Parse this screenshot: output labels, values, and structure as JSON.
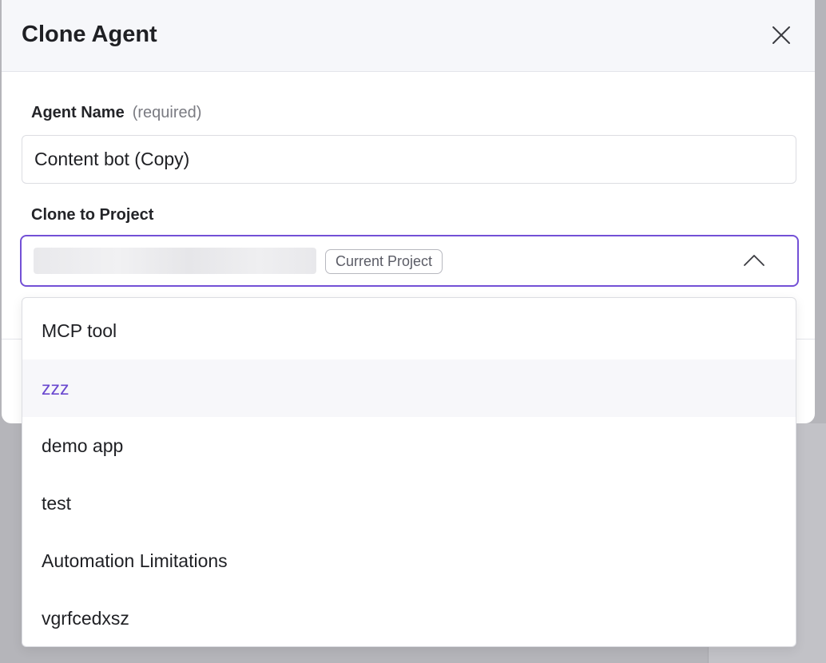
{
  "dialog": {
    "title": "Clone Agent"
  },
  "agent_name": {
    "label": "Agent Name",
    "hint": "(required)",
    "value": "Content bot (Copy)"
  },
  "clone_to_project": {
    "label": "Clone to Project",
    "selected_badge": "Current Project"
  },
  "dropdown": {
    "options": [
      {
        "label": "MCP tool"
      },
      {
        "label": "zzz"
      },
      {
        "label": "demo app"
      },
      {
        "label": "test"
      },
      {
        "label": "Automation Limitations"
      },
      {
        "label": "vgrfcedxsz"
      }
    ]
  },
  "colors": {
    "accent": "#7350d6",
    "hover_text": "#6a48cf"
  },
  "icons": {
    "close": "close-icon",
    "chevron": "chevron-up-icon"
  }
}
